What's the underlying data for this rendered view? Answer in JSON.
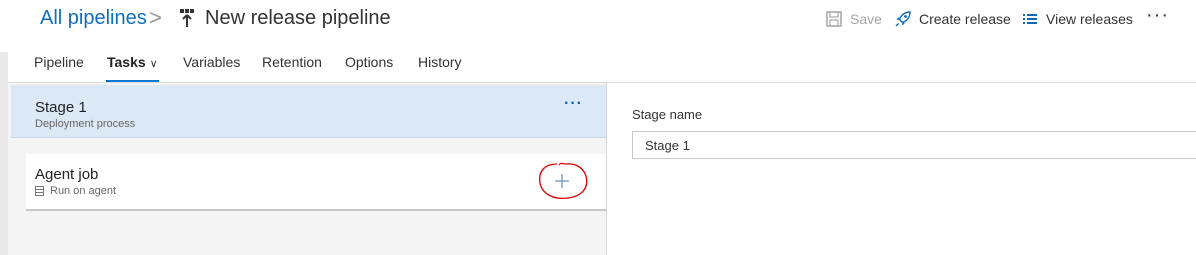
{
  "breadcrumb": {
    "parent": "All pipelines",
    "separator": ">",
    "title": "New release pipeline"
  },
  "toolbar": {
    "save_label": "Save",
    "create_release_label": "Create release",
    "view_releases_label": "View releases",
    "more_label": "···"
  },
  "tabs": [
    {
      "label": "Pipeline"
    },
    {
      "label": "Tasks",
      "active": true
    },
    {
      "label": "Variables"
    },
    {
      "label": "Retention"
    },
    {
      "label": "Options"
    },
    {
      "label": "History"
    }
  ],
  "stage": {
    "title": "Stage 1",
    "subtitle": "Deployment process",
    "more": "···"
  },
  "agent_job": {
    "title": "Agent job",
    "subtitle": "Run on agent",
    "add_label": "+"
  },
  "stage_form": {
    "label": "Stage name",
    "value": "Stage 1"
  },
  "colors": {
    "link_blue": "#106ebe",
    "accent": "#0078d7",
    "selected_stage_bg": "#dbe8f6",
    "annotation_red": "#e00000"
  },
  "icons": {
    "pipeline": "release-pipeline-icon",
    "save": "save-disk-icon",
    "create": "rocket-icon",
    "view": "list-icon",
    "agent": "server-icon",
    "add": "plus-icon"
  }
}
